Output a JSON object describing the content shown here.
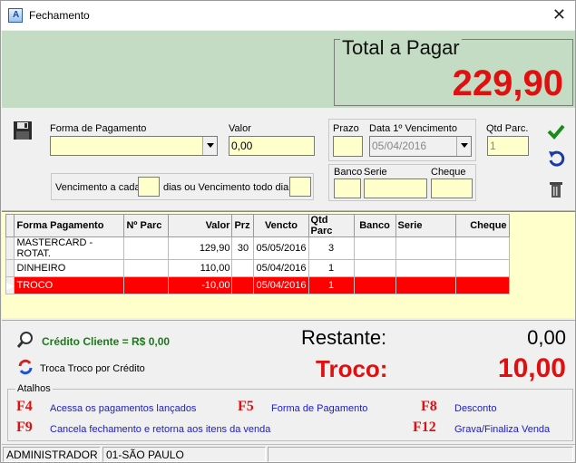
{
  "window": {
    "title": "Fechamento"
  },
  "total": {
    "label": "Total a Pagar",
    "value": "229,90"
  },
  "form": {
    "forma_label": "Forma de Pagamento",
    "forma_value": "",
    "valor_label": "Valor",
    "valor_value": "0,00",
    "prazo_label": "Prazo",
    "prazo_value": "",
    "data_label": "Data 1º Vencimento",
    "data_value": "05/04/2016",
    "qtd_label": "Qtd Parc.",
    "qtd_value": "1",
    "venc_label": "Vencimento a cada",
    "venc_value": "",
    "dias_label": "dias ou Vencimento todo dia",
    "dia_value": "",
    "banco_label": "Banco",
    "serie_label": "Serie",
    "cheque_label": "Cheque"
  },
  "table": {
    "headers": [
      "Forma Pagamento",
      "Nº Parc",
      "Valor",
      "Prz",
      "Vencto",
      "Qtd Parc",
      "Banco",
      "Serie",
      "Cheque"
    ],
    "rows": [
      [
        "MASTERCARD - ROTAT.",
        "",
        "129,90",
        "30",
        "05/05/2016",
        "3",
        "",
        "",
        ""
      ],
      [
        "DINHEIRO",
        "",
        "110,00",
        "",
        "05/04/2016",
        "1",
        "",
        "",
        ""
      ],
      [
        "TROCO",
        "",
        "-10,00",
        "",
        "05/04/2016",
        "1",
        "",
        "",
        ""
      ]
    ]
  },
  "summary": {
    "credito": "Crédito Cliente = R$ 0,00",
    "troca": "Troca Troco por Crédito",
    "restante_label": "Restante:",
    "restante_value": "0,00",
    "troco_label": "Troco:",
    "troco_value": "10,00"
  },
  "atalhos": {
    "title": "Atalhos",
    "items": [
      {
        "key": "F4",
        "desc": "Acessa os pagamentos lançados"
      },
      {
        "key": "F5",
        "desc": "Forma de Pagamento"
      },
      {
        "key": "F8",
        "desc": "Desconto"
      },
      {
        "key": "F9",
        "desc": "Cancela fechamento e retorna aos itens da venda"
      },
      {
        "key": "F12",
        "desc": "Grava/Finaliza Venda"
      }
    ]
  },
  "status": {
    "user": "ADMINISTRADOR",
    "store": "01-SÃO PAULO"
  },
  "colors": {
    "accent_red": "#e01010",
    "green_panel": "#c3dcc3",
    "input_yellow": "#ffffcc"
  },
  "icons": [
    "save-icon",
    "check-icon",
    "undo-icon",
    "trash-icon",
    "search-user-icon",
    "refresh-icon",
    "close-icon"
  ]
}
